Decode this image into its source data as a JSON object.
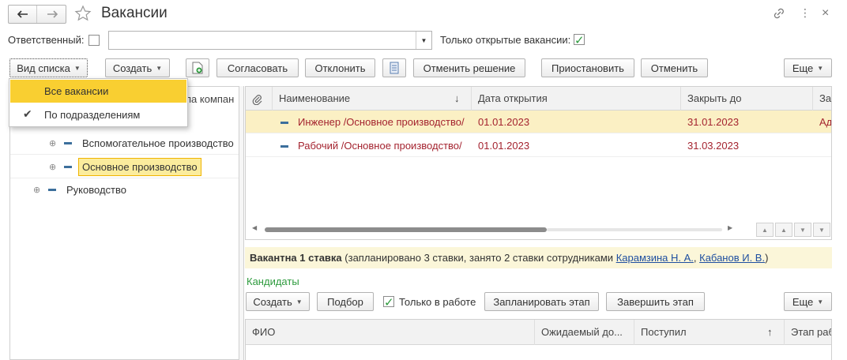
{
  "window": {
    "title": "Вакансии",
    "nav": {
      "back_icon": "arrow-left-icon",
      "forward_icon": "arrow-right-icon"
    }
  },
  "filters": {
    "responsible_label": "Ответственный:",
    "responsible_value": "",
    "open_only_label": "Только открытые вакансии:",
    "open_only_checked": true
  },
  "toolbar": {
    "view_list": "Вид списка",
    "create": "Создать",
    "approve": "Согласовать",
    "reject": "Отклонить",
    "cancel_decision": "Отменить решение",
    "suspend": "Приостановить",
    "cancel": "Отменить",
    "more": "Еще"
  },
  "view_menu": {
    "items": [
      {
        "label": "Все вакансии",
        "selected": true,
        "checked": false
      },
      {
        "label": "По подразделениям",
        "selected": false,
        "checked": true
      }
    ]
  },
  "tree": {
    "partial_header": "па компан",
    "items": [
      {
        "label": "Вспомогательное производство"
      },
      {
        "label": "Основное производство"
      },
      {
        "label": "Руководство"
      }
    ]
  },
  "vacancies_table": {
    "columns": [
      "Наименование",
      "Дата открытия",
      "Закрыть до",
      "За"
    ],
    "sort_icon": "↓",
    "rows": [
      {
        "name": "Инженер /Основное производство/",
        "opened": "01.01.2023",
        "close_by": "31.01.2023",
        "extra": "Ад"
      },
      {
        "name": "Рабочий /Основное производство/",
        "opened": "01.01.2023",
        "close_by": "31.03.2023",
        "extra": ""
      }
    ]
  },
  "info_bar": {
    "bold": "Вакантна 1 ставка",
    "text": " (запланировано 3 ставки, занято 2 ставки сотрудниками ",
    "link1": "Карамзина Н. А.",
    "sep": ", ",
    "link2": "Кабанов И. В.",
    "end": ")"
  },
  "candidates": {
    "title": "Кандидаты",
    "create": "Создать",
    "pick": "Подбор",
    "in_work_label": "Только в работе",
    "in_work_checked": true,
    "plan_stage": "Запланировать этап",
    "finish_stage": "Завершить этап",
    "more": "Еще",
    "columns": [
      "ФИО",
      "Ожидаемый до...",
      "Поступил",
      "Этап раб"
    ],
    "sort_icon": "↑"
  },
  "colors": {
    "accent_yellow": "#f9cf31",
    "selected_row": "#fbf0c4",
    "red_text": "#a4232f",
    "green": "#2e9b3e",
    "link": "#1f4fa0"
  }
}
